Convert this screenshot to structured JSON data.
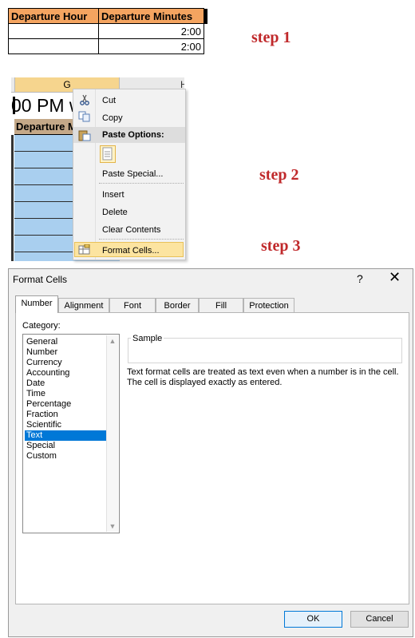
{
  "step1": {
    "headers": [
      "Departure Hour",
      "Departure Minutes"
    ],
    "rows": [
      [
        "",
        "2:00"
      ],
      [
        "",
        "2:00"
      ]
    ],
    "label": "step 1"
  },
  "step2": {
    "column_selected": "G",
    "column_next": "H",
    "cell_text": "00 PM w",
    "header_cell": "Departure M",
    "label": "step 2",
    "menu": {
      "cut": "Cut",
      "copy": "Copy",
      "paste_options": "Paste Options:",
      "paste_special": "Paste Special...",
      "insert": "Insert",
      "delete": "Delete",
      "clear_contents": "Clear Contents",
      "format_cells": "Format Cells..."
    }
  },
  "step3": {
    "label": "step 3"
  },
  "dialog": {
    "title": "Format Cells",
    "help": "?",
    "close": "✕",
    "tabs": [
      "Number",
      "Alignment",
      "Font",
      "Border",
      "Fill",
      "Protection"
    ],
    "active_tab": "Number",
    "category_label": "Category:",
    "categories": [
      "General",
      "Number",
      "Currency",
      "Accounting",
      "Date",
      "Time",
      "Percentage",
      "Fraction",
      "Scientific",
      "Text",
      "Special",
      "Custom"
    ],
    "selected_category": "Text",
    "sample_label": "Sample",
    "description": "Text format cells are treated as text even when a number is in the cell. The cell is displayed exactly as entered.",
    "ok_label": "OK",
    "cancel_label": "Cancel"
  },
  "colors": {
    "header_fill": "#F4A460",
    "step_text": "#C0292B",
    "selection_blue": "#0078D7",
    "menu_highlight": "#FCE4A0"
  }
}
